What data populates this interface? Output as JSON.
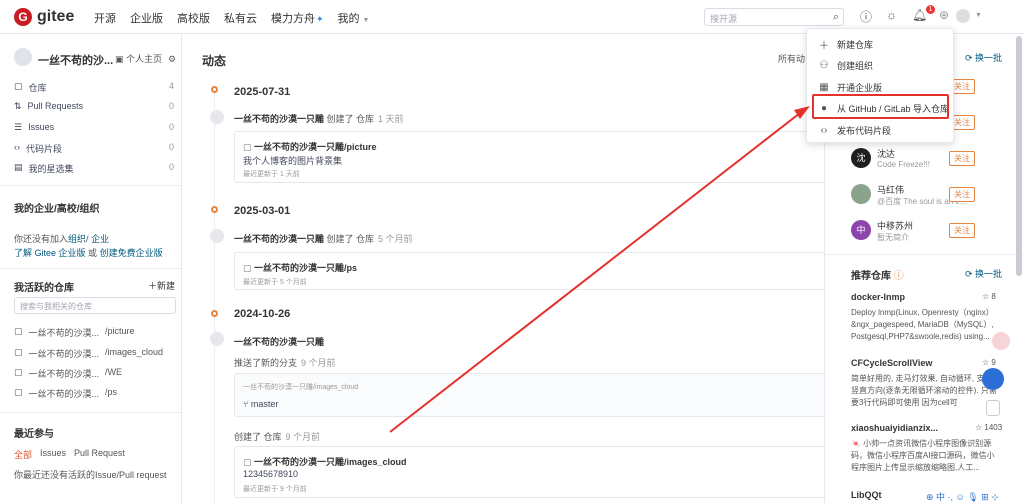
{
  "app": {
    "logo_letter": "G",
    "logo_text": "gitee"
  },
  "nav": [
    "开源",
    "企业版",
    "高校版",
    "私有云",
    "模力方舟",
    "我的"
  ],
  "search": {
    "placeholder": "搜开源"
  },
  "notif_count": "1",
  "sidebar": {
    "user": "一丝不苟的沙...",
    "home_link": "个人主页",
    "items": [
      {
        "label": "仓库",
        "count": "4"
      },
      {
        "label": "Pull Requests",
        "count": "0"
      },
      {
        "label": "Issues",
        "count": "0"
      },
      {
        "label": "代码片段",
        "count": "0"
      },
      {
        "label": "我的星选集",
        "count": "0"
      }
    ],
    "org_head": "我的企业/高校/组织",
    "org_text1": "你还没有加入",
    "org_link1": "组织",
    "org_sep": "/",
    "org_link2": "企业",
    "org_text2": "了解 Gitee 企业版",
    "org_or": "或",
    "org_link3": "创建免费企业版",
    "active_head": "我活跃的仓库",
    "new_label": "新建",
    "repo_search": "搜索与我相关的仓库",
    "repos": [
      {
        "owner": "一丝不苟的沙漠...",
        "name": "/picture"
      },
      {
        "owner": "一丝不苟的沙漠...",
        "name": "/images_cloud"
      },
      {
        "owner": "一丝不苟的沙漠...",
        "name": "/WE"
      },
      {
        "owner": "一丝不苟的沙漠...",
        "name": "/ps"
      }
    ],
    "recent_head": "最近参与",
    "filters": [
      "全部",
      "Issues",
      "Pull Request"
    ],
    "recent_empty": "你最近还没有活跃的Issue/Pull request"
  },
  "main": {
    "title": "动态",
    "all_label": "所有动",
    "groups": [
      {
        "date": "2025-07-31",
        "user": "一丝不苟的沙漠一只雕",
        "action": "创建了 仓库",
        "time": "1 天前",
        "repo": "一丝不苟的沙漠一只雕/picture",
        "desc": "我个人博客的图片背景集",
        "updated": "最近更新于 1 天前"
      },
      {
        "date": "2025-03-01",
        "user": "一丝不苟的沙漠一只雕",
        "action": "创建了 仓库",
        "time": "5 个月前",
        "repo": "一丝不苟的沙漠一只雕/ps",
        "desc": "",
        "updated": "最近更新于 5 个月前"
      },
      {
        "date": "2024-10-26",
        "user": "一丝不苟的沙漠一只雕",
        "action": "推送了新的分支",
        "time": "9 个月前",
        "branch_repo": "一丝不苟的沙漠一只雕/images_cloud",
        "branch": "master",
        "action2": "创建了 仓库",
        "time2": "9 个月前",
        "repo": "一丝不苟的沙漠一只雕/images_cloud",
        "desc": "12345678910",
        "updated": "最近更新于 9 个月前"
      }
    ]
  },
  "right": {
    "follow_label": "关注",
    "collapse": "换一批",
    "users": [
      {
        "name": "沈达",
        "sub": "Code Freeze!!!",
        "avatar_text": "沈",
        "color": "#1f1f1f"
      },
      {
        "name": "马红伟",
        "sub": "@百度 The soul is an e...",
        "avatar_text": "",
        "color": "#8aa38a"
      },
      {
        "name": "中移苏州",
        "sub": "暂无简介",
        "avatar_text": "中",
        "color": "#8e44ad"
      }
    ],
    "rec_head": "推荐仓库",
    "repos": [
      {
        "name": "docker-lnmp",
        "stars": "8",
        "desc": "Deploy lnmp(Linux, Openresty（nginx）&ngx_pagespeed, MariaDB（MySQL）, Postgesql,PHP7&swoole,redis) using..."
      },
      {
        "name": "CFCycleScrollView",
        "stars": "9",
        "desc": "简单好用的, 走马灯效果, 自动循环, 支持竖直方向(逐条无限循环滚动的控件). 只需要3行代码即可使用 因为cell可"
      },
      {
        "name": "xiaoshuaiyidianzix...",
        "stars": "1403",
        "desc": "🍬 小帅一点资讯微信小程序图像识别源码，微信小程序百度AI接口源码，微信小程序图片上传显示缩放缩略图,人工..."
      },
      {
        "name": "LibQQt",
        "stars": "",
        "desc": ""
      }
    ]
  },
  "dropdown": {
    "items": [
      {
        "icon": "plus-icon",
        "label": "新建仓库"
      },
      {
        "icon": "org-icon",
        "label": "创建组织"
      },
      {
        "icon": "enterprise-icon",
        "label": "开通企业版"
      },
      {
        "icon": "github-icon",
        "label": "从 GitHub / GitLab 导入仓库"
      },
      {
        "icon": "code-icon",
        "label": "发布代码片段"
      }
    ]
  },
  "colors": {
    "brand": "#c71d23",
    "accent": "#e8843e",
    "link": "#005980",
    "highlight": "#e5312c"
  }
}
